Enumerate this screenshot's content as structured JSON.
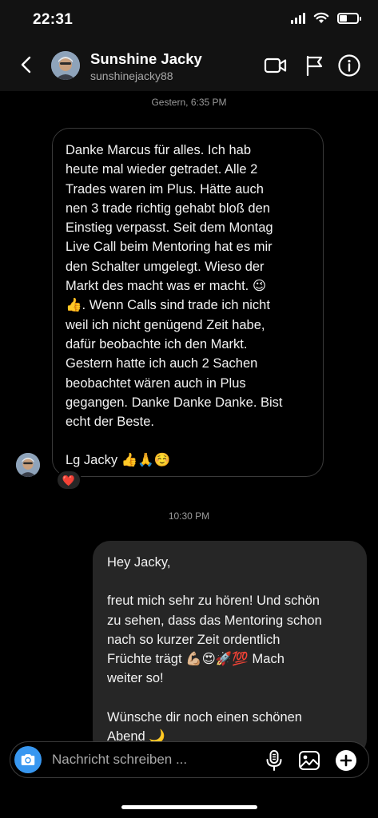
{
  "status_bar": {
    "time": "22:31"
  },
  "header": {
    "name": "Sunshine Jacky",
    "handle": "sunshinejacky88",
    "icons": [
      "back-chevron-icon",
      "video-call-icon",
      "flag-icon",
      "info-icon"
    ]
  },
  "messages": {
    "stamp_1": "Gestern, 6:35 PM",
    "incoming": {
      "lines": [
        "Danke Marcus für alles. Ich hab",
        "heute mal wieder getradet. Alle 2",
        "Trades waren im Plus. Hätte auch",
        "nen 3 trade richtig gehabt bloß den",
        "Einstieg verpasst. Seit dem Montag",
        "Live Call beim Mentoring hat es mir",
        "den Schalter umgelegt. Wieso der",
        "Markt des macht was er macht. 😉",
        "👍. Wenn Calls sind trade ich nicht",
        "weil ich nicht genügend Zeit habe,",
        "dafür beobachte ich den Markt.",
        "Gestern hatte ich auch 2 Sachen",
        "beobachtet wären auch in Plus",
        "gegangen. Danke Danke Danke. Bist",
        "echt der Beste."
      ],
      "signature": "Lg Jacky 👍🙏☺️",
      "reaction": "❤️"
    },
    "stamp_2": "10:30 PM",
    "outgoing": {
      "greeting": "Hey Jacky,",
      "lines": [
        "freut mich sehr zu hören! Und schön",
        "zu sehen, dass das Mentoring schon",
        "nach so kurzer Zeit ordentlich",
        "Früchte trägt 💪🏼😍🚀💯 Mach",
        "weiter so!"
      ],
      "closing_lines": [
        "Wünsche dir noch einen schönen",
        "Abend 🌙"
      ]
    }
  },
  "composer": {
    "placeholder": "Nachricht schreiben ...",
    "icons": [
      "camera-icon",
      "microphone-icon",
      "gallery-icon",
      "add-icon"
    ]
  },
  "colors": {
    "accent": "#3897f0",
    "bubble_out": "#262626",
    "background": "#000000"
  }
}
